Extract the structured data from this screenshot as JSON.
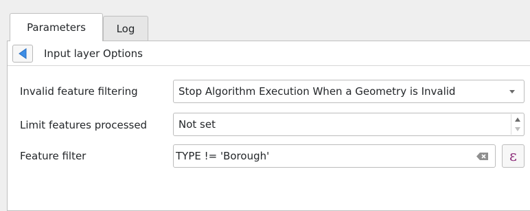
{
  "tabs": [
    {
      "label": "Parameters",
      "active": true
    },
    {
      "label": "Log",
      "active": false
    }
  ],
  "header": {
    "back_icon": "triangle-left-icon",
    "title": "Input layer Options"
  },
  "fields": {
    "invalid_filtering": {
      "label": "Invalid feature filtering",
      "value": "Stop Algorithm Execution When a Geometry is Invalid"
    },
    "limit_features": {
      "label": "Limit features processed",
      "value": "Not set"
    },
    "feature_filter": {
      "label": "Feature filter",
      "value": "TYPE != 'Borough'",
      "expression_glyph": "ε"
    }
  },
  "colors": {
    "accent": "#3d8ee6",
    "background": "#efefef",
    "panel": "#ffffff",
    "border": "#bcbcbc",
    "expression_button_glyph": "#8e2e7a"
  }
}
